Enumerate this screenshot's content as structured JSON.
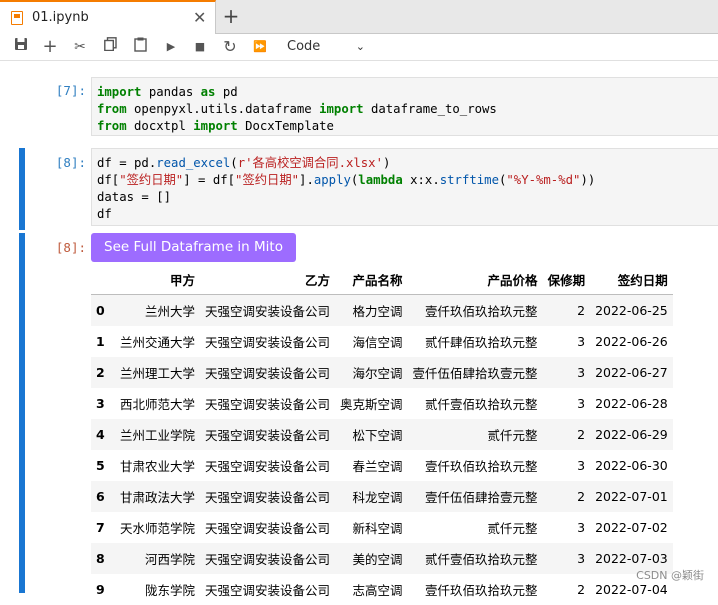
{
  "tab": {
    "title": "01.ipynb",
    "close": "✕",
    "add": "+"
  },
  "toolbar": {
    "save": "💾",
    "insert": "+",
    "cut": "✂",
    "copy": "⧉",
    "paste": "📋",
    "run": "▶",
    "stop": "■",
    "restart": "↻",
    "run_all": "⏩",
    "cell_type": "Code",
    "chevron": "⌄"
  },
  "cells": [
    {
      "prompt": "[7]:"
    },
    {
      "prompt": "[8]:"
    },
    {
      "prompt": "[8]:"
    }
  ],
  "code": {
    "c1": [
      "import",
      " pandas ",
      "as",
      " pd",
      "from",
      " openpyxl.utils.dataframe ",
      "import",
      " dataframe_to_rows",
      "from",
      " docxtpl ",
      "import",
      " DocxTemplate"
    ],
    "c2": {
      "l1a": "df = pd.",
      "l1b": "read_excel",
      "l1c": "(",
      "l1d": "r'各高校空调合同.xlsx'",
      "l1e": ")",
      "l2a": "df[",
      "l2b": "\"签约日期\"",
      "l2c": "] = df[",
      "l2d": "\"签约日期\"",
      "l2e": "].",
      "l2f": "apply",
      "l2g": "(",
      "l2h": "lambda",
      "l2i": " x:x.",
      "l2j": "strftime",
      "l2k": "(",
      "l2l": "\"%Y-%m-%d\"",
      "l2m": "))",
      "l3": "datas = []",
      "l4": "df"
    }
  },
  "mito_button": "See Full Dataframe in Mito",
  "dataframe": {
    "columns": [
      "",
      "甲方",
      "乙方",
      "产品名称",
      "产品价格",
      "保修期",
      "签约日期"
    ],
    "rows": [
      [
        "0",
        "兰州大学",
        "天强空调安装设备公司",
        "格力空调",
        "壹仟玖佰玖拾玖元整",
        "2",
        "2022-06-25"
      ],
      [
        "1",
        "兰州交通大学",
        "天强空调安装设备公司",
        "海信空调",
        "贰仟肆佰玖拾玖元整",
        "3",
        "2022-06-26"
      ],
      [
        "2",
        "兰州理工大学",
        "天强空调安装设备公司",
        "海尔空调",
        "壹仟伍佰肆拾玖壹元整",
        "3",
        "2022-06-27"
      ],
      [
        "3",
        "西北师范大学",
        "天强空调安装设备公司",
        "奥克斯空调",
        "贰仟壹佰玖拾玖元整",
        "3",
        "2022-06-28"
      ],
      [
        "4",
        "兰州工业学院",
        "天强空调安装设备公司",
        "松下空调",
        "贰仟元整",
        "2",
        "2022-06-29"
      ],
      [
        "5",
        "甘肃农业大学",
        "天强空调安装设备公司",
        "春兰空调",
        "壹仟玖佰玖拾玖元整",
        "3",
        "2022-06-30"
      ],
      [
        "6",
        "甘肃政法大学",
        "天强空调安装设备公司",
        "科龙空调",
        "壹仟伍佰肆拾壹元整",
        "2",
        "2022-07-01"
      ],
      [
        "7",
        "天水师范学院",
        "天强空调安装设备公司",
        "新科空调",
        "贰仟元整",
        "3",
        "2022-07-02"
      ],
      [
        "8",
        "河西学院",
        "天强空调安装设备公司",
        "美的空调",
        "贰仟壹佰玖拾玖元整",
        "3",
        "2022-07-03"
      ],
      [
        "9",
        "陇东学院",
        "天强空调安装设备公司",
        "志高空调",
        "壹仟玖佰玖拾玖元整",
        "2",
        "2022-07-04"
      ]
    ]
  },
  "watermark": "CSDN @颖街",
  "colors": {
    "accent": "#1976d2",
    "mito": "#9d6cff",
    "tab_accent": "#f57c00"
  }
}
